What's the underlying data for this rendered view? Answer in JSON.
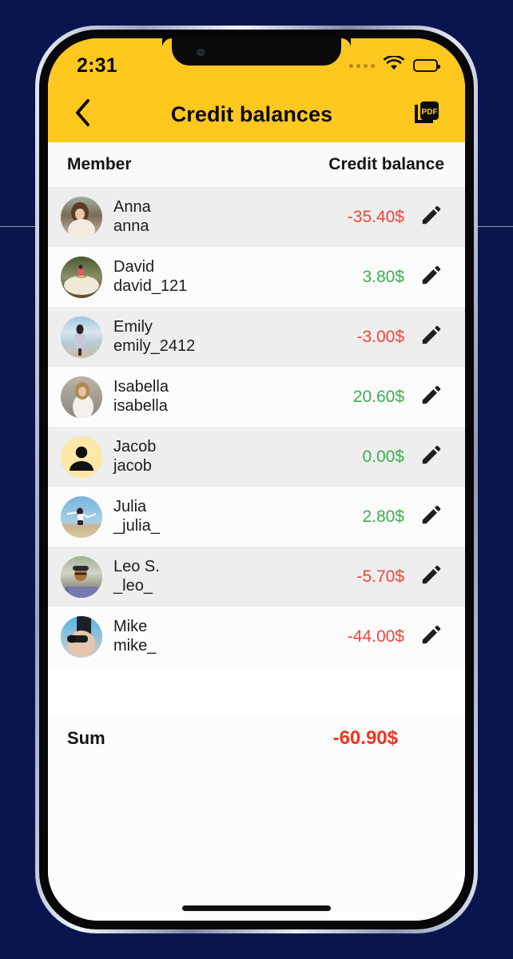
{
  "status_bar": {
    "time": "2:31",
    "signal_icon": "cellular-dots-icon",
    "wifi_icon": "wifi-icon",
    "battery_icon": "battery-full-icon"
  },
  "header": {
    "back_icon": "chevron-left-icon",
    "title": "Credit balances",
    "pdf_icon": "pdf-export-icon",
    "pdf_label": "PDF",
    "background_color": "#FFC81E"
  },
  "table": {
    "columns": [
      "Member",
      "Credit balance"
    ],
    "rows": [
      {
        "name": "Anna",
        "username": "anna",
        "balance": "-35.40$",
        "sign": "neg",
        "avatar": "photo-anna",
        "edit_icon": "pencil-icon"
      },
      {
        "name": "David",
        "username": "david_121",
        "balance": "3.80$",
        "sign": "pos",
        "avatar": "photo-david",
        "edit_icon": "pencil-icon"
      },
      {
        "name": "Emily",
        "username": "emily_2412",
        "balance": "-3.00$",
        "sign": "neg",
        "avatar": "photo-emily",
        "edit_icon": "pencil-icon"
      },
      {
        "name": "Isabella",
        "username": "isabella",
        "balance": "20.60$",
        "sign": "pos",
        "avatar": "photo-isabella",
        "edit_icon": "pencil-icon"
      },
      {
        "name": "Jacob",
        "username": "jacob",
        "balance": "0.00$",
        "sign": "pos",
        "avatar": "placeholder-person",
        "edit_icon": "pencil-icon"
      },
      {
        "name": "Julia",
        "username": "_julia_",
        "balance": "2.80$",
        "sign": "pos",
        "avatar": "photo-julia",
        "edit_icon": "pencil-icon"
      },
      {
        "name": "Leo S.",
        "username": "_leo_",
        "balance": "-5.70$",
        "sign": "neg",
        "avatar": "photo-leo",
        "edit_icon": "pencil-icon"
      },
      {
        "name": "Mike",
        "username": "mike_",
        "balance": "-44.00$",
        "sign": "neg",
        "avatar": "photo-mike",
        "edit_icon": "pencil-icon"
      }
    ]
  },
  "summary": {
    "label": "Sum",
    "value": "-60.90$"
  },
  "colors": {
    "accent_yellow": "#FFC81E",
    "negative": "#F4443A",
    "positive": "#3CAE4F",
    "sum_negative": "#F4321F",
    "row_alt": "#EEEEEE",
    "backdrop": "#0A1550"
  }
}
